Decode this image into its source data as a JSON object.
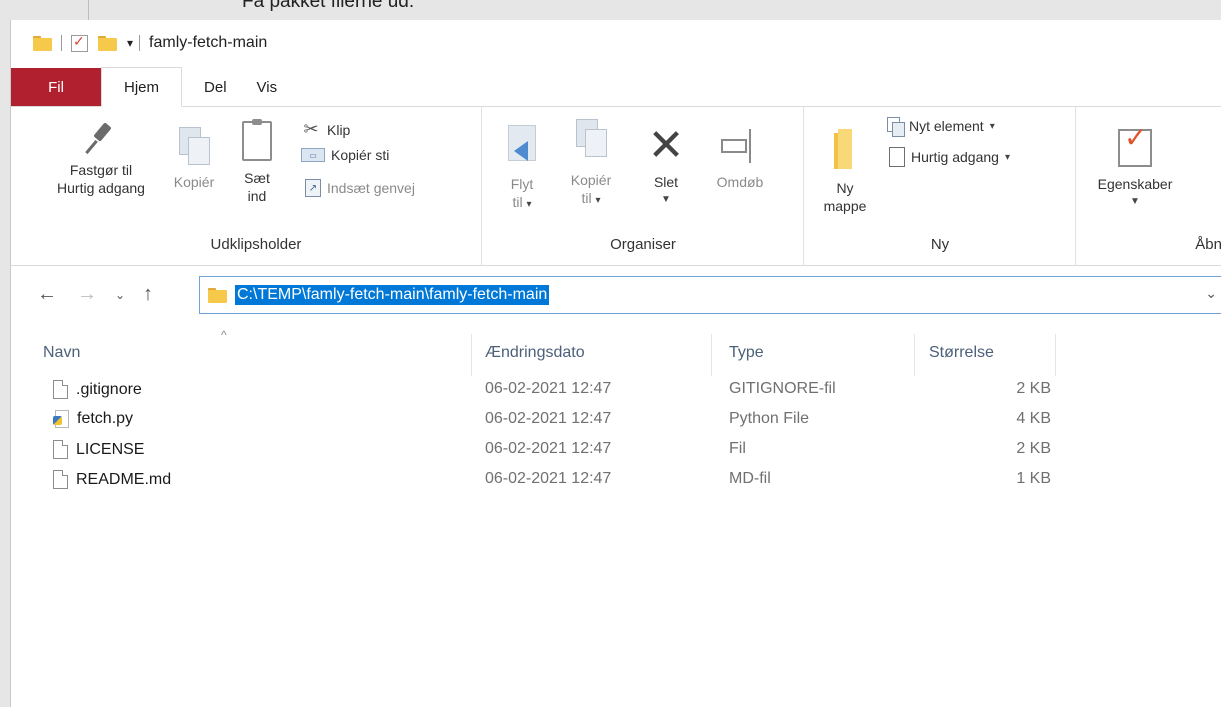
{
  "background_text": "Få pakket filerne ud:",
  "window": {
    "title": "famly-fetch-main",
    "quick_access_dropdown": "▾"
  },
  "tabs": [
    "Fil",
    "Hjem",
    "Del",
    "Vis"
  ],
  "ribbon": {
    "clipboard": {
      "pin_line1": "Fastgør til",
      "pin_line2": "Hurtig adgang",
      "copy": "Kopiér",
      "paste_line1": "Sæt",
      "paste_line2": "ind",
      "cut": "Klip",
      "copy_path": "Kopiér sti",
      "paste_shortcut": "Indsæt genvej",
      "label": "Udklipsholder"
    },
    "organize": {
      "move_line1": "Flyt",
      "move_line2": "til",
      "copyto_line1": "Kopiér",
      "copyto_line2": "til",
      "delete": "Slet",
      "rename": "Omdøb",
      "label": "Organiser"
    },
    "new": {
      "folder_line1": "Ny",
      "folder_line2": "mappe",
      "new_item": "Nyt element",
      "easy_access": "Hurtig adgang",
      "label": "Ny"
    },
    "open": {
      "properties": "Egenskaber",
      "label": "Åbn"
    }
  },
  "address": {
    "path": "C:\\TEMP\\famly-fetch-main\\famly-fetch-main"
  },
  "columns": {
    "name": "Navn",
    "date": "Ændringsdato",
    "type": "Type",
    "size": "Størrelse"
  },
  "files": [
    {
      "name": ".gitignore",
      "date": "06-02-2021 12:47",
      "type": "GITIGNORE-fil",
      "size": "2 KB",
      "icon": "file-icon"
    },
    {
      "name": "fetch.py",
      "date": "06-02-2021 12:47",
      "type": "Python File",
      "size": "4 KB",
      "icon": "python-file-icon"
    },
    {
      "name": "LICENSE",
      "date": "06-02-2021 12:47",
      "type": "Fil",
      "size": "2 KB",
      "icon": "file-icon"
    },
    {
      "name": "README.md",
      "date": "06-02-2021 12:47",
      "type": "MD-fil",
      "size": "1 KB",
      "icon": "file-icon"
    }
  ],
  "colors": {
    "file_tab": "#b0202f",
    "selection": "#0078d7",
    "folder": "#f7c94a"
  }
}
